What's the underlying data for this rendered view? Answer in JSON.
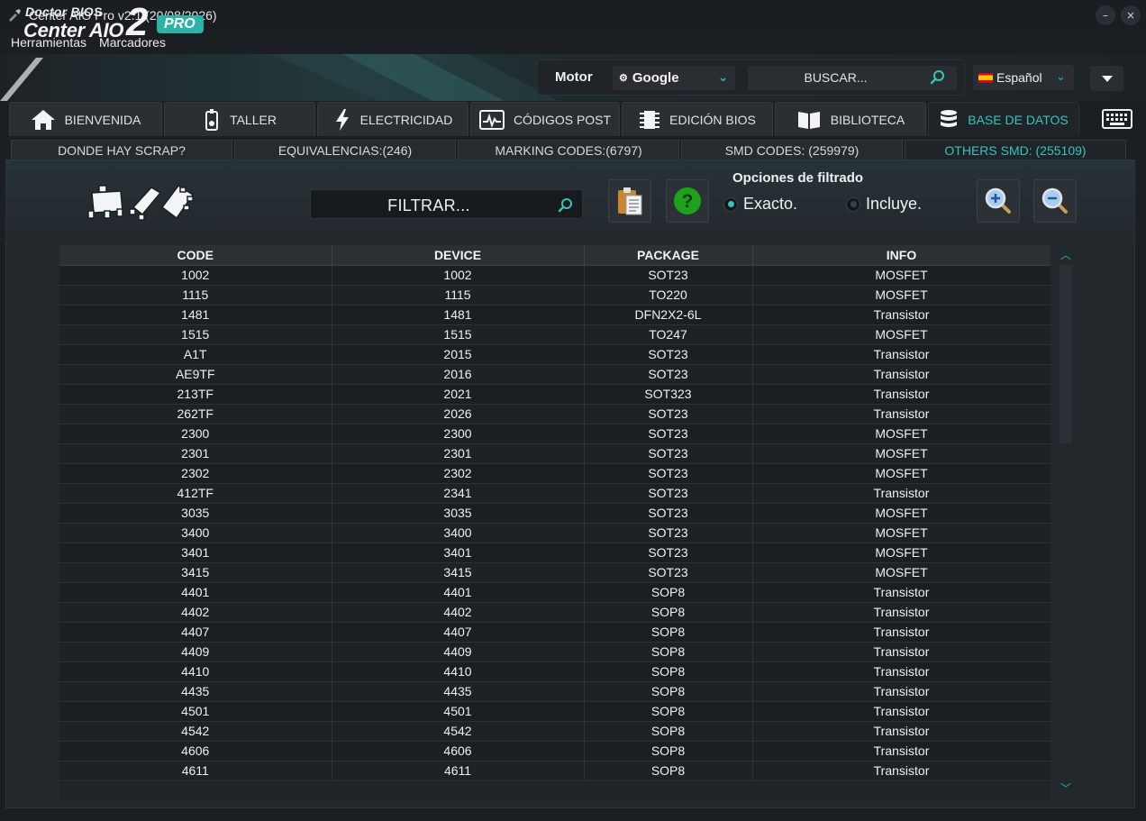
{
  "window": {
    "title": "Center AIO Pro v2.1 (20/08/2026)",
    "controls": {
      "minimize": "–",
      "close": "×"
    }
  },
  "menu": [
    "Herramientas",
    "Marcadores"
  ],
  "brand": {
    "line1": "Doctor BIOS",
    "line2": "Center AIO",
    "number": "2",
    "badge": "PRO"
  },
  "search_engine": {
    "label": "Motor",
    "selected": "Google",
    "placeholder": "BUSCAR..."
  },
  "language": {
    "selected": "Español"
  },
  "main_tabs": [
    {
      "label": "BIENVENIDA",
      "icon": "home-icon",
      "active": false
    },
    {
      "label": "TALLER",
      "icon": "phone-repair-icon",
      "active": false
    },
    {
      "label": "ELECTRICIDAD",
      "icon": "lightning-icon",
      "active": false
    },
    {
      "label": "CÓDIGOS POST",
      "icon": "post-card-icon",
      "active": false
    },
    {
      "label": "EDICIÓN BIOS",
      "icon": "chip-icon",
      "active": false
    },
    {
      "label": "BIBLIOTECA",
      "icon": "book-icon",
      "active": false
    },
    {
      "label": "BASE DE DATOS",
      "icon": "database-icon",
      "active": true
    }
  ],
  "sub_tabs": [
    {
      "label": "DONDE HAY SCRAP?",
      "active": false
    },
    {
      "label": "EQUIVALENCIAS:(246)",
      "active": false
    },
    {
      "label": "MARKING CODES:(6797)",
      "active": false
    },
    {
      "label": "SMD CODES: (259979)",
      "active": false
    },
    {
      "label": "OTHERS SMD: (255109)",
      "active": true
    }
  ],
  "filter": {
    "placeholder": "FILTRAR...",
    "options_title": "Opciones de filtrado",
    "exact_label": "Exacto.",
    "includes_label": "Incluye.",
    "selected": "Exacto."
  },
  "colors": {
    "accent": "#39c3b7",
    "background": "#1b1e22",
    "help_green": "#1ea21e"
  },
  "table": {
    "columns": [
      "CODE",
      "DEVICE",
      "PACKAGE",
      "INFO"
    ],
    "rows": [
      [
        "1002",
        "1002",
        "SOT23",
        "MOSFET"
      ],
      [
        "1115",
        "1115",
        "TO220",
        "MOSFET"
      ],
      [
        "1481",
        "1481",
        "DFN2X2-6L",
        "Transistor"
      ],
      [
        "1515",
        "1515",
        "TO247",
        "MOSFET"
      ],
      [
        "A1T",
        "2015",
        "SOT23",
        "Transistor"
      ],
      [
        "AE9TF",
        "2016",
        "SOT23",
        "Transistor"
      ],
      [
        "213TF",
        "2021",
        "SOT323",
        "Transistor"
      ],
      [
        "262TF",
        "2026",
        "SOT23",
        "Transistor"
      ],
      [
        "2300",
        "2300",
        "SOT23",
        "MOSFET"
      ],
      [
        "2301",
        "2301",
        "SOT23",
        "MOSFET"
      ],
      [
        "2302",
        "2302",
        "SOT23",
        "MOSFET"
      ],
      [
        "412TF",
        "2341",
        "SOT23",
        "Transistor"
      ],
      [
        "3035",
        "3035",
        "SOT23",
        "MOSFET"
      ],
      [
        "3400",
        "3400",
        "SOT23",
        "MOSFET"
      ],
      [
        "3401",
        "3401",
        "SOT23",
        "MOSFET"
      ],
      [
        "3415",
        "3415",
        "SOT23",
        "MOSFET"
      ],
      [
        "4401",
        "4401",
        "SOP8",
        "Transistor"
      ],
      [
        "4402",
        "4402",
        "SOP8",
        "Transistor"
      ],
      [
        "4407",
        "4407",
        "SOP8",
        "Transistor"
      ],
      [
        "4409",
        "4409",
        "SOP8",
        "Transistor"
      ],
      [
        "4410",
        "4410",
        "SOP8",
        "Transistor"
      ],
      [
        "4435",
        "4435",
        "SOP8",
        "Transistor"
      ],
      [
        "4501",
        "4501",
        "SOP8",
        "Transistor"
      ],
      [
        "4542",
        "4542",
        "SOP8",
        "Transistor"
      ],
      [
        "4606",
        "4606",
        "SOP8",
        "Transistor"
      ],
      [
        "4611",
        "4611",
        "SOP8",
        "Transistor"
      ]
    ]
  }
}
